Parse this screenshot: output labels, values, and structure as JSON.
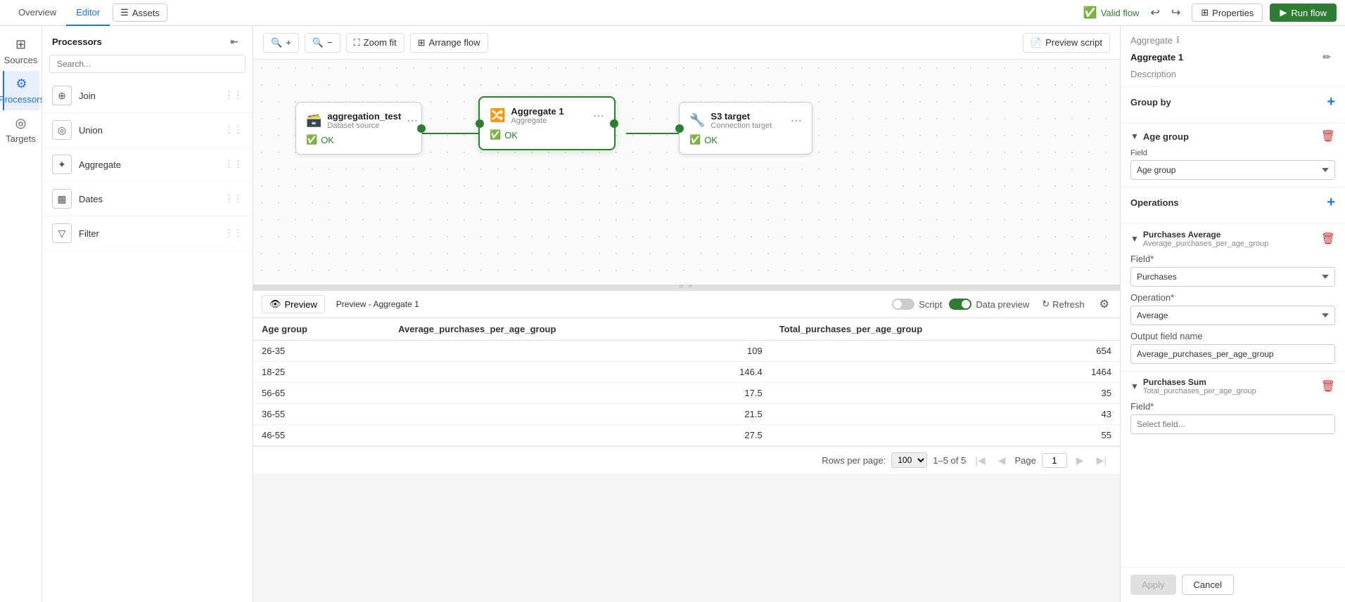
{
  "topbar": {
    "tabs": [
      "Overview",
      "Editor",
      "Assets"
    ],
    "active_tab": "Editor",
    "valid_flow_label": "Valid flow",
    "properties_label": "Properties",
    "run_flow_label": "Run flow"
  },
  "sidebar": {
    "items": [
      {
        "id": "sources",
        "label": "Sources",
        "icon": "⊞"
      },
      {
        "id": "processors",
        "label": "Processors",
        "icon": "⚙"
      },
      {
        "id": "targets",
        "label": "Targets",
        "icon": "◎"
      }
    ],
    "active": "processors"
  },
  "processors_panel": {
    "title": "Processors",
    "search_placeholder": "Search...",
    "items": [
      {
        "name": "Join",
        "icon": "⊕"
      },
      {
        "name": "Union",
        "icon": "◎"
      },
      {
        "name": "Aggregate",
        "icon": "★"
      },
      {
        "name": "Dates",
        "icon": "📅"
      },
      {
        "name": "Filter",
        "icon": "⊿"
      }
    ]
  },
  "canvas_toolbar": {
    "zoom_in_label": "+",
    "zoom_out_label": "−",
    "zoom_fit_label": "Zoom fit",
    "arrange_flow_label": "Arrange flow",
    "preview_script_label": "Preview script"
  },
  "flow_nodes": {
    "source_node": {
      "title": "aggregation_test",
      "subtitle": "Dataset source",
      "status": "OK"
    },
    "aggregate_node": {
      "title": "Aggregate 1",
      "subtitle": "Aggregate",
      "status": "OK"
    },
    "target_node": {
      "title": "S3 target",
      "subtitle": "Connection target",
      "status": "OK"
    }
  },
  "preview": {
    "tab_label": "Preview",
    "title": "Preview - Aggregate 1",
    "script_label": "Script",
    "data_preview_label": "Data preview",
    "refresh_label": "Refresh",
    "table": {
      "columns": [
        "Age group",
        "Average_purchases_per_age_group",
        "Total_purchases_per_age_group"
      ],
      "rows": [
        {
          "age_group": "26-35",
          "avg": "109",
          "total": "654"
        },
        {
          "age_group": "18-25",
          "avg": "146.4",
          "total": "1464"
        },
        {
          "age_group": "56-65",
          "avg": "17.5",
          "total": "35"
        },
        {
          "age_group": "36-55",
          "avg": "21.5",
          "total": "43"
        },
        {
          "age_group": "46-55",
          "avg": "27.5",
          "total": "55"
        }
      ]
    },
    "pagination": {
      "rows_per_page_label": "Rows per page:",
      "rows_per_page_value": "100",
      "range_label": "1–5 of 5",
      "page_label": "Page",
      "page_value": "1"
    }
  },
  "right_panel": {
    "section_label": "Aggregate",
    "title": "Aggregate 1",
    "description": "Description",
    "group_by_label": "Group by",
    "group_by_field_label": "Age group",
    "group_by_field_value": "Age group",
    "operations_label": "Operations",
    "operation1": {
      "title": "Purchases Average",
      "subtitle": "Average_purchases_per_age_group",
      "field_label": "Field*",
      "field_value": "Purchases",
      "operation_label": "Operation*",
      "operation_value": "Average",
      "output_label": "Output field name",
      "output_value": "Average_purchases_per_age_group"
    },
    "operation2": {
      "title": "Purchases Sum",
      "subtitle": "Total_purchases_per_age_group",
      "field_label": "Field*",
      "field_value": ""
    },
    "apply_label": "Apply",
    "cancel_label": "Cancel"
  }
}
